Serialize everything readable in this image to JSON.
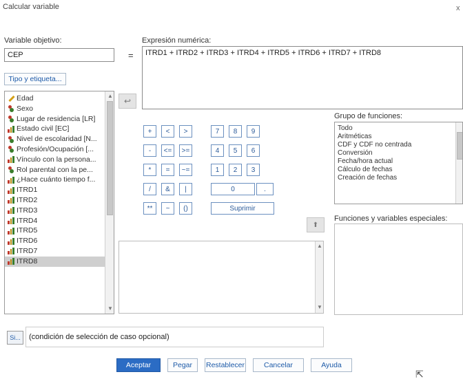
{
  "window": {
    "title": "Calcular variable",
    "close": "x"
  },
  "target": {
    "label": "Variable objetivo:",
    "value": "CEP"
  },
  "equals": "=",
  "type_label_button": "Tipo y etiqueta...",
  "expression": {
    "label": "Expresión numérica:",
    "value": "ITRD1 + ITRD2 + ITRD3 + ITRD4 + ITRD5 + ITRD6 + ITRD7 + ITRD8"
  },
  "variables": [
    {
      "label": "Edad",
      "icon": "pencil-scale-icon"
    },
    {
      "label": "Sexo",
      "icon": "nominal-icon"
    },
    {
      "label": "Lugar de residencia [LR]",
      "icon": "nominal-icon"
    },
    {
      "label": "Estado civil [EC]",
      "icon": "scale-icon"
    },
    {
      "label": "Nivel de escolaridad [N...",
      "icon": "nominal-icon"
    },
    {
      "label": "Profesión/Ocupación [...",
      "icon": "nominal-icon"
    },
    {
      "label": "Vínculo con la persona...",
      "icon": "scale-icon"
    },
    {
      "label": "Rol parental con la pe...",
      "icon": "nominal-icon"
    },
    {
      "label": "¿Hace cuánto tiempo f...",
      "icon": "scale-icon"
    },
    {
      "label": "ITRD1",
      "icon": "scale-icon"
    },
    {
      "label": "ITRD2",
      "icon": "scale-icon"
    },
    {
      "label": "ITRD3",
      "icon": "scale-icon"
    },
    {
      "label": "ITRD4",
      "icon": "scale-icon"
    },
    {
      "label": "ITRD5",
      "icon": "scale-icon"
    },
    {
      "label": "ITRD6",
      "icon": "scale-icon"
    },
    {
      "label": "ITRD7",
      "icon": "scale-icon"
    },
    {
      "label": "ITRD8",
      "icon": "scale-icon",
      "selected": true
    }
  ],
  "keypad": {
    "row1": [
      "+",
      "<",
      ">",
      "7",
      "8",
      "9"
    ],
    "row2": [
      "-",
      "<=",
      ">=",
      "4",
      "5",
      "6"
    ],
    "row3": [
      "*",
      "=",
      "~=",
      "1",
      "2",
      "3"
    ],
    "row4": [
      "/",
      "&",
      "|",
      "0",
      "."
    ],
    "row5": [
      "**",
      "~",
      "()"
    ],
    "delete": "Suprimir"
  },
  "function_group": {
    "label": "Grupo de funciones:",
    "items": [
      "Todo",
      "Aritméticas",
      "CDF y CDF no centrada",
      "Conversión",
      "Fecha/hora actual",
      "Cálculo de fechas",
      "Creación de fechas"
    ]
  },
  "functions_label": "Funciones y variables especiales:",
  "if_button": "Si...",
  "if_text": "(condición de selección de caso opcional)",
  "buttons": {
    "ok": "Aceptar",
    "paste": "Pegar",
    "reset": "Restablecer",
    "cancel": "Cancelar",
    "help": "Ayuda"
  },
  "colors": {
    "primary": "#2b6cc4",
    "accent_text": "#1d5aa8"
  }
}
